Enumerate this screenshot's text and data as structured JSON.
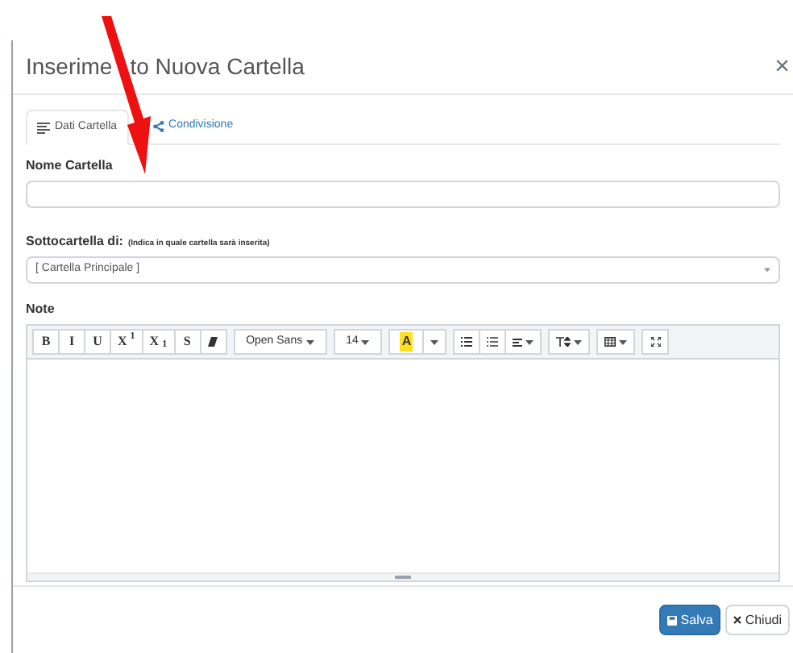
{
  "dialog": {
    "title": [
      "Inserime",
      "to Nuova Cartella"
    ],
    "close": "×",
    "tabs": [
      {
        "label": "Dati Cartella",
        "selected": true
      },
      {
        "label": "Condivisione",
        "selected": false
      }
    ],
    "name_field": {
      "label": "Nome Cartella"
    },
    "parent_field": {
      "label": "Sottocartella di:",
      "hint": "(Indica in quale cartella sarà inserita)",
      "value": "[ Cartella Principale ]"
    },
    "notes": {
      "label": "Note",
      "toolbar": [
        [
          {
            "kind": "text",
            "label": "B"
          },
          {
            "kind": "text",
            "label": "I"
          },
          {
            "kind": "text",
            "label": "U"
          },
          {
            "kind": "text",
            "label": "X$^{1}$"
          },
          {
            "kind": "text",
            "label": "X$_{1}$"
          },
          {
            "kind": "text",
            "label": "S"
          },
          {
            "kind": "eraser"
          }
        ],
        [
          {
            "kind": "dropdown",
            "label": "Open Sans"
          }
        ],
        [
          {
            "kind": "dropdown",
            "label": "14"
          }
        ],
        [
          {
            "kind": "highlight",
            "label": "A"
          },
          {
            "kind": "caret"
          }
        ],
        [
          {
            "kind": "bullets"
          },
          {
            "kind": "numbers"
          },
          {
            "kind": "align"
          }
        ],
        [
          {
            "kind": "lineheight"
          }
        ],
        [
          {
            "kind": "table"
          }
        ],
        [
          {
            "kind": "fullscreen"
          }
        ]
      ]
    },
    "buttons": [
      {
        "kind": "primary",
        "label": "Salva"
      },
      {
        "kind": "default",
        "label": "Chiudi"
      }
    ]
  }
}
